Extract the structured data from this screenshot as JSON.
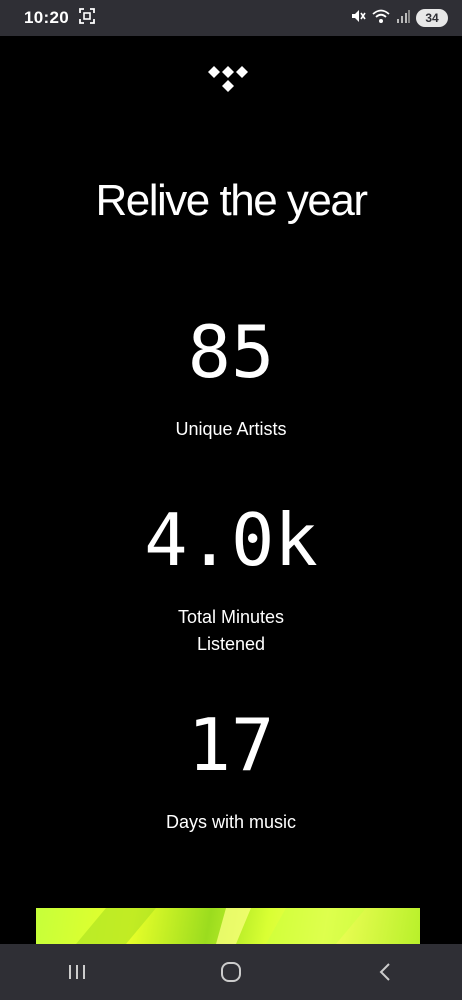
{
  "status_bar": {
    "time": "10:20",
    "battery": "34",
    "icons": [
      "screenshot-icon",
      "mute-icon",
      "wifi-icon",
      "signal-icon",
      "battery-icon"
    ]
  },
  "header": {
    "logo": "tidal-logo-icon",
    "title": "Relive the year"
  },
  "stats": [
    {
      "value": "85",
      "label_lines": [
        "Unique Artists"
      ]
    },
    {
      "value": "4.0k",
      "label_lines": [
        "Total Minutes",
        "Listened"
      ]
    },
    {
      "value": "17",
      "label_lines": [
        "Days with music"
      ]
    }
  ],
  "promo": {
    "colors": [
      "#c6ff3a",
      "#e8ff2a",
      "#9bdc1e"
    ]
  },
  "nav_bar": {
    "icons": [
      "recent-apps-icon",
      "home-icon",
      "back-icon"
    ]
  },
  "colors": {
    "background": "#000000",
    "system_bar": "#2f2f35",
    "text": "#ffffff"
  }
}
